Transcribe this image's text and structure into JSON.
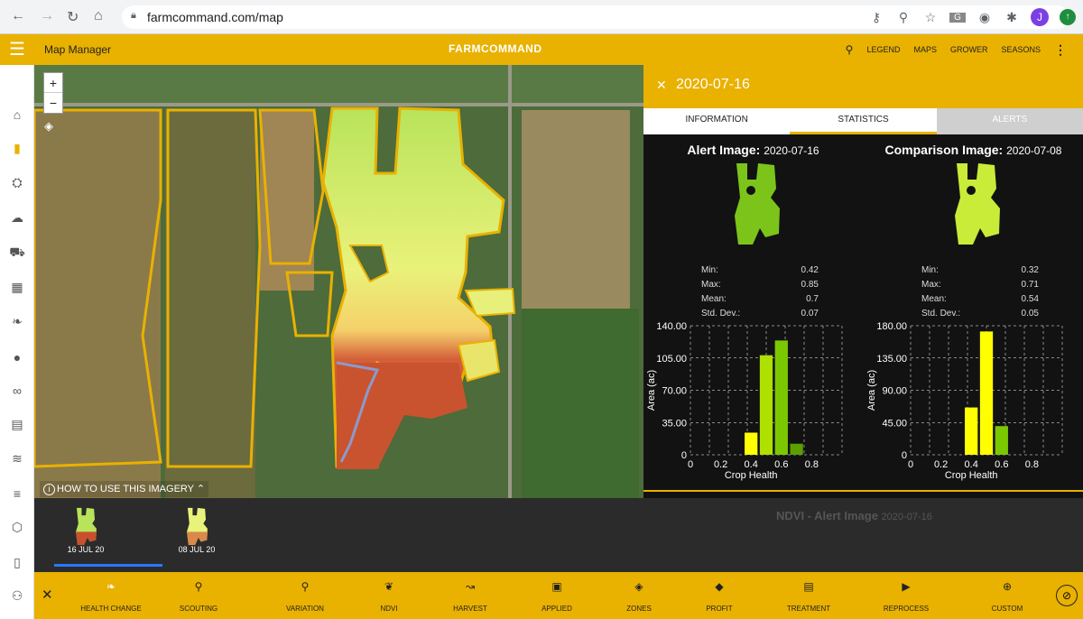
{
  "browser": {
    "url": "farmcommand.com/map",
    "back": "←",
    "forward": "→",
    "reload": "↻",
    "home": "⌂",
    "avatar_letter": "J"
  },
  "topbar": {
    "title": "Map Manager",
    "logo": "FARMCOMMAND",
    "nav": [
      "LEGEND",
      "MAPS",
      "GROWER",
      "SEASONS"
    ]
  },
  "map": {
    "help_text": "HOW TO USE THIS IMAGERY"
  },
  "panel": {
    "date": "2020-07-16",
    "tabs": [
      "INFORMATION",
      "STATISTICS",
      "ALERTS"
    ],
    "active_tab": "STATISTICS",
    "alert": {
      "title": "Alert Image:",
      "date": "2020-07-16",
      "stats": [
        {
          "label": "Min:",
          "value": "0.42"
        },
        {
          "label": "Max:",
          "value": "0.85"
        },
        {
          "label": "Mean:",
          "value": "0.7"
        },
        {
          "label": "Std. Dev.:",
          "value": "0.07"
        }
      ]
    },
    "comparison": {
      "title": "Comparison Image:",
      "date": "2020-07-08",
      "stats": [
        {
          "label": "Min:",
          "value": "0.32"
        },
        {
          "label": "Max:",
          "value": "0.71"
        },
        {
          "label": "Mean:",
          "value": "0.54"
        },
        {
          "label": "Std. Dev.:",
          "value": "0.05"
        }
      ]
    }
  },
  "chart_data": [
    {
      "type": "bar",
      "xlabel": "Crop Health",
      "ylabel": "Area (ac)",
      "x": [
        0.4,
        0.5,
        0.6,
        0.7
      ],
      "values": [
        24,
        108,
        124,
        12
      ],
      "colors": [
        "#ffff00",
        "#aee000",
        "#7cc800",
        "#5aa000"
      ],
      "ylim": [
        0,
        140
      ],
      "yticks": [
        "0",
        "35.00",
        "70.00",
        "105.00",
        "140.00"
      ],
      "xticks": [
        "0",
        "0.2",
        "0.4",
        "0.6",
        "0.8"
      ],
      "grid": true
    },
    {
      "type": "bar",
      "xlabel": "Crop Health",
      "ylabel": "Area (ac)",
      "x": [
        0.4,
        0.5,
        0.6
      ],
      "values": [
        66,
        172,
        40
      ],
      "colors": [
        "#ffff00",
        "#ffff00",
        "#7cc800"
      ],
      "ylim": [
        0,
        180
      ],
      "yticks": [
        "0",
        "45.00",
        "90.00",
        "135.00",
        "180.00"
      ],
      "xticks": [
        "0",
        "0.2",
        "0.4",
        "0.6",
        "0.8"
      ],
      "grid": true
    }
  ],
  "imagery": {
    "layer_title": "NDVI - Alert Image",
    "layer_date": "2020-07-16",
    "cards": [
      {
        "label": "16 JUL 20",
        "selected": true
      },
      {
        "label": "08 JUL 20",
        "selected": false
      }
    ]
  },
  "bottombar": {
    "items": [
      {
        "label": "HEALTH CHANGE",
        "icon": "health-change-icon",
        "glyph": "❧"
      },
      {
        "label": "SCOUTING",
        "icon": "scouting-icon",
        "glyph": "⚲"
      },
      {
        "label": "VARIATION",
        "icon": "variation-icon",
        "glyph": "⚲"
      },
      {
        "label": "NDVI",
        "icon": "ndvi-icon",
        "glyph": "❦"
      },
      {
        "label": "HARVEST",
        "icon": "harvest-icon",
        "glyph": "↝"
      },
      {
        "label": "APPLIED",
        "icon": "applied-icon",
        "glyph": "▣"
      },
      {
        "label": "ZONES",
        "icon": "zones-icon",
        "glyph": "◈"
      },
      {
        "label": "PROFIT",
        "icon": "profit-icon",
        "glyph": "◆"
      },
      {
        "label": "TREATMENT",
        "icon": "treatment-icon",
        "glyph": "▤"
      },
      {
        "label": "REPROCESS",
        "icon": "play-icon",
        "glyph": "▶"
      },
      {
        "label": "CUSTOM",
        "icon": "plus-circle-icon",
        "glyph": "⊕"
      }
    ]
  }
}
